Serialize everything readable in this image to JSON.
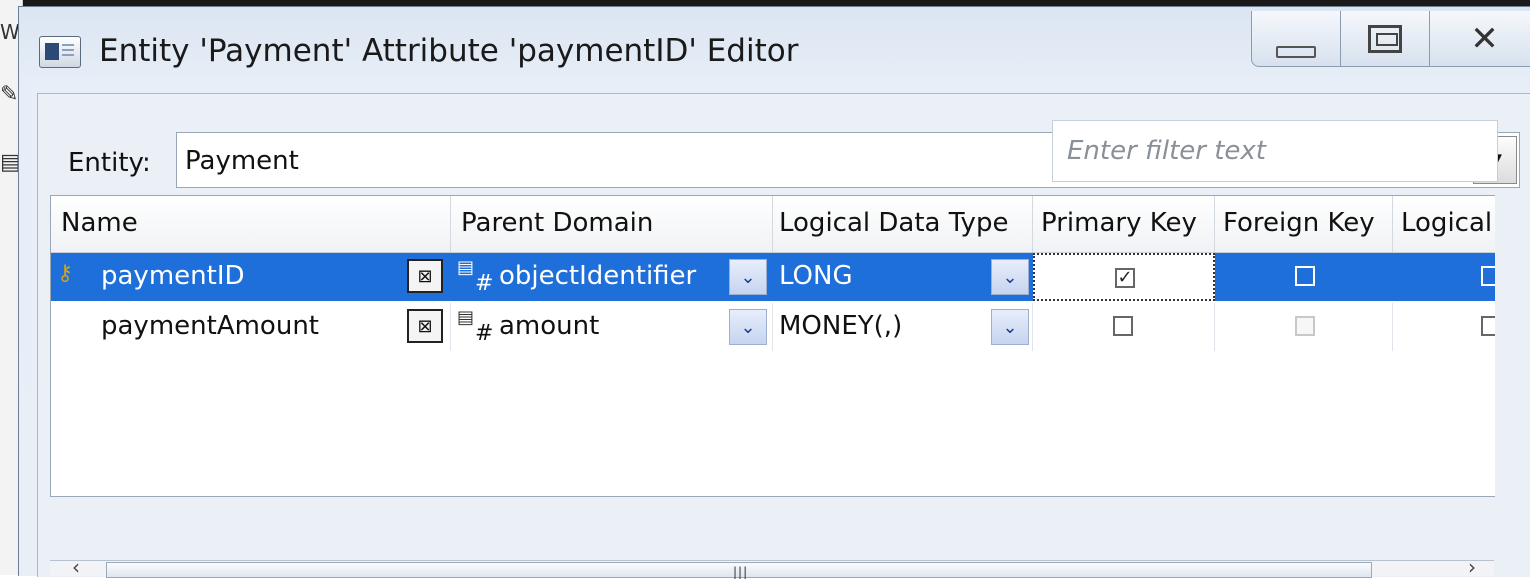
{
  "window": {
    "title": "Entity 'Payment' Attribute 'paymentID' Editor",
    "controls": {
      "minimize": "minimize",
      "maximize": "maximize",
      "close": "✕"
    }
  },
  "entity": {
    "label": "Entity:",
    "value": "Payment"
  },
  "toolbar": {
    "items": [
      {
        "name": "first-icon",
        "glyph": "⏮",
        "disabled": true
      },
      {
        "name": "last-icon",
        "glyph": "⏭",
        "disabled": false
      },
      {
        "name": "new-child-icon",
        "glyph": "⧉",
        "disabled": false
      },
      {
        "name": "new-attribute-icon",
        "glyph": "✚",
        "disabled": false
      },
      {
        "name": "delete-icon",
        "glyph": "▮",
        "disabled": false
      },
      {
        "name": "reorder-icon",
        "glyph": "⇅",
        "disabled": false
      },
      {
        "name": "move-top-icon",
        "glyph": "⤒",
        "disabled": true
      },
      {
        "name": "move-up-icon",
        "glyph": "⇧",
        "disabled": true
      },
      {
        "name": "move-down-icon",
        "glyph": "⇩",
        "disabled": true
      },
      {
        "name": "move-bottom-icon",
        "glyph": "⤓",
        "disabled": true
      },
      {
        "name": "copy-icon",
        "glyph": "⧈",
        "disabled": false
      },
      {
        "name": "eraser-icon",
        "glyph": "◈",
        "disabled": false
      }
    ]
  },
  "filter": {
    "placeholder": "Enter filter text",
    "value": ""
  },
  "grid": {
    "columns": [
      "Name",
      "Parent Domain",
      "Logical Data Type",
      "Primary Key",
      "Foreign Key",
      "Logical"
    ],
    "rows": [
      {
        "name": "paymentID",
        "parent_domain": "objectIdentifier",
        "data_type": "LONG",
        "primary_key": true,
        "foreign_key": false,
        "logical": false,
        "selected": true
      },
      {
        "name": "paymentAmount",
        "parent_domain": "amount",
        "data_type": "MONEY(,)",
        "primary_key": false,
        "foreign_key": false,
        "logical": false,
        "selected": false
      }
    ]
  },
  "colors": {
    "selection": "#1e6fd9",
    "window_frame": "#dbe5f1"
  }
}
